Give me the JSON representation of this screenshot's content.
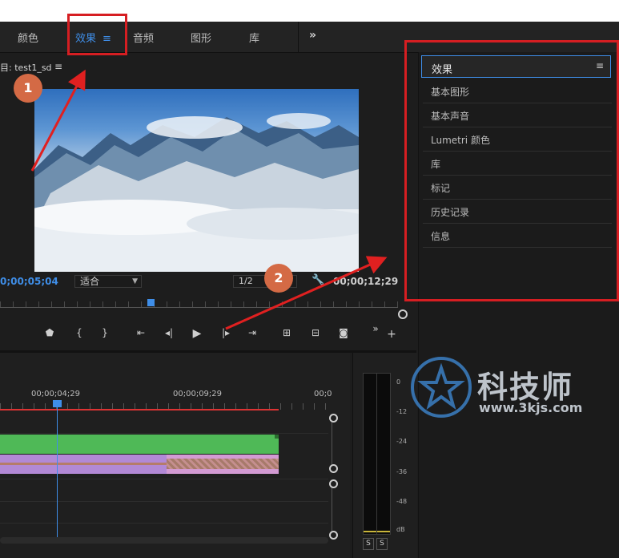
{
  "tabs": {
    "items": [
      {
        "label": "颜色"
      },
      {
        "label": "效果"
      },
      {
        "label": "音频"
      },
      {
        "label": "图形"
      },
      {
        "label": "库"
      }
    ],
    "active_menu_icon": "≡",
    "more_icon": "»"
  },
  "monitor": {
    "title": "目: test1_sd",
    "menu_icon": "≡",
    "timecode_current": "0;00;05;04",
    "fit_select": "适合",
    "resolution_select": "1/2",
    "timecode_total": "00;00;12;29"
  },
  "timeline": {
    "ruler_labels": [
      "00;00;04;29",
      "00;00;09;29",
      "00;0"
    ]
  },
  "meter": {
    "db_labels": [
      "0",
      "-12",
      "-24",
      "-36",
      "-48",
      "dB"
    ],
    "solo_labels": [
      "S",
      "S"
    ]
  },
  "effects_panel": {
    "header": "效果",
    "header_menu": "≡",
    "items": [
      "基本图形",
      "基本声音",
      "Lumetri 颜色",
      "库",
      "标记",
      "历史记录",
      "信息"
    ]
  },
  "annotations": {
    "badge1": "1",
    "badge2": "2"
  },
  "watermark": {
    "title": "科技师",
    "url": "www.3kjs.com"
  },
  "colors": {
    "accent_blue": "#3f8ee8",
    "highlight_red": "#d61e22",
    "badge_orange": "#d46a45",
    "clip_green": "#4fb957",
    "clip_purple": "#b289d6"
  }
}
